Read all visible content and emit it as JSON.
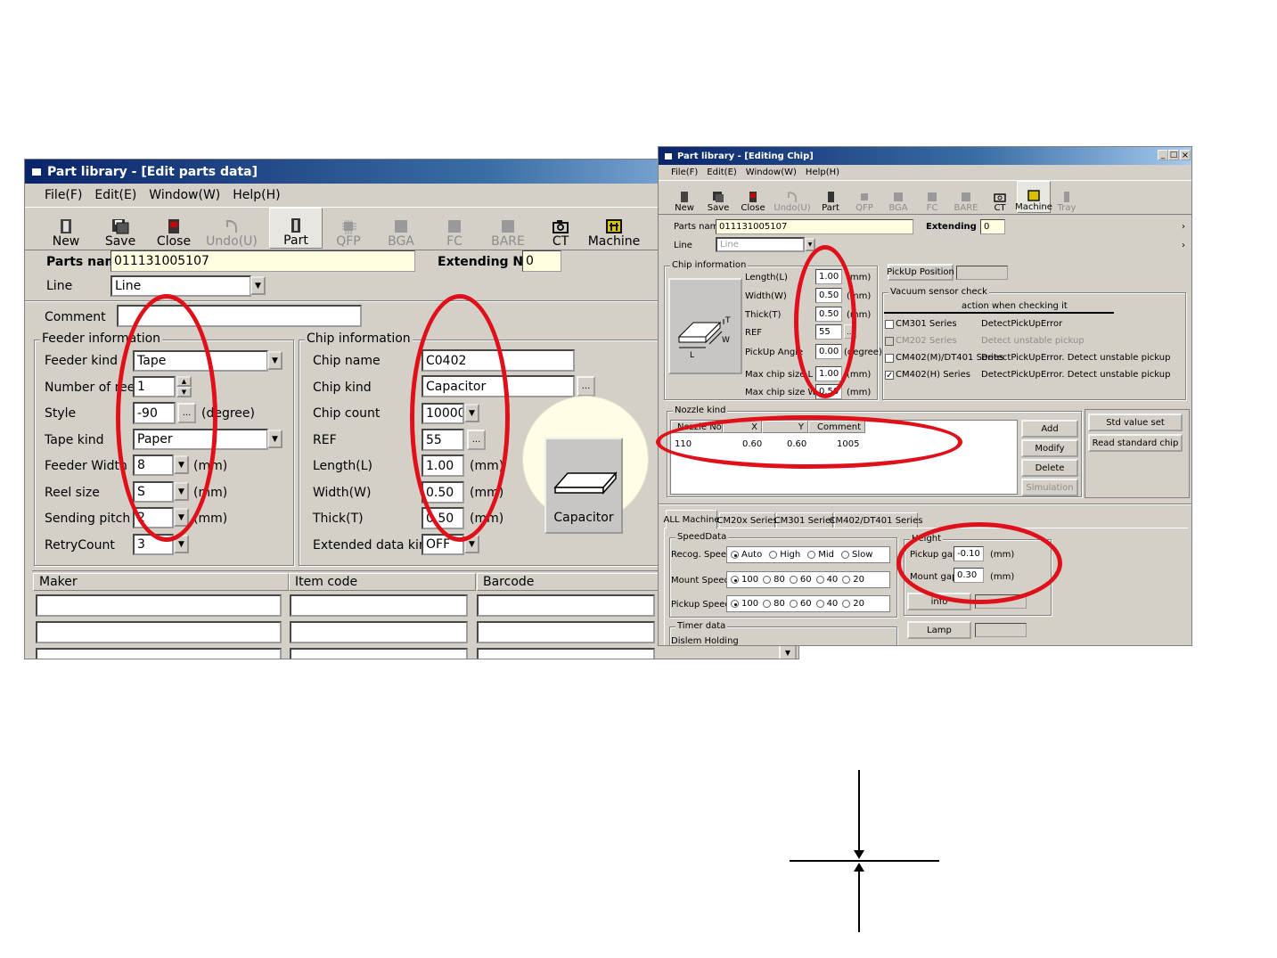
{
  "left_window": {
    "title": "Part library - [Edit parts data]",
    "menu": [
      "File(F)",
      "Edit(E)",
      "Window(W)",
      "Help(H)"
    ],
    "toolbar": [
      "New",
      "Save",
      "Close",
      "Undo(U)",
      "Part",
      "QFP",
      "BGA",
      "FC",
      "BARE",
      "CT",
      "Machine"
    ],
    "parts_name_label": "Parts name",
    "parts_name_value": "011131005107",
    "extending_label": "Extending No",
    "extending_value": "0",
    "line_label": "Line",
    "line_value": "Line",
    "comment_label": "Comment",
    "comment_value": "",
    "feeder": {
      "title": "Feeder information",
      "kind_label": "Feeder kind",
      "kind_value": "Tape",
      "reel_label": "Number of reel",
      "reel_value": "1",
      "style_label": "Style",
      "style_value": "-90",
      "style_unit": "(degree)",
      "tape_label": "Tape kind",
      "tape_value": "Paper",
      "width_label": "Feeder Width",
      "width_value": "8",
      "width_unit": "(mm)",
      "reelsize_label": "Reel size",
      "reelsize_value": "S",
      "reelsize_unit": "(mm)",
      "pitch_label": "Sending pitch",
      "pitch_value": "2",
      "pitch_unit": "(mm)",
      "retry_label": "RetryCount",
      "retry_value": "3"
    },
    "chip": {
      "title": "Chip information",
      "name_label": "Chip name",
      "name_value": "C0402",
      "kind_label": "Chip kind",
      "kind_value": "Capacitor",
      "count_label": "Chip count",
      "count_value": "10000",
      "ref_label": "REF",
      "ref_value": "55",
      "length_label": "Length(L)",
      "length_value": "1.00",
      "length_unit": "(mm)",
      "width_label": "Width(W)",
      "width_value": "0.50",
      "width_unit": "(mm)",
      "thick_label": "Thick(T)",
      "thick_value": "0.50",
      "thick_unit": "(mm)",
      "ext_label": "Extended data kind",
      "ext_value": "OFF",
      "preview_label": "Capacitor"
    },
    "table_headers": [
      "Maker",
      "Item code",
      "Barcode"
    ]
  },
  "right_window": {
    "title": "Part library - [Editing Chip]",
    "menu": [
      "File(F)",
      "Edit(E)",
      "Window(W)",
      "Help(H)"
    ],
    "toolbar": [
      "New",
      "Save",
      "Close",
      "Undo(U)",
      "Part",
      "QFP",
      "BGA",
      "FC",
      "BARE",
      "CT",
      "Machine",
      "Tray"
    ],
    "parts_name_label": "Parts name",
    "parts_name_value": "011131005107",
    "extending_label": "Extending No",
    "extending_value": "0",
    "line_label": "Line",
    "line_value": "Line",
    "chipinfo": {
      "title": "Chip information",
      "length_label": "Length(L)",
      "length_value": "1.00",
      "length_unit": "(mm)",
      "width_label": "Width(W)",
      "width_value": "0.50",
      "width_unit": "(mm)",
      "thick_label": "Thick(T)",
      "thick_value": "0.50",
      "thick_unit": "(mm)",
      "ref_label": "REF",
      "ref_value": "55",
      "angle_label": "PickUp Angle",
      "angle_value": "0.00",
      "angle_unit": "(degree)",
      "maxl_label": "Max chip size L",
      "maxl_value": "1.00",
      "maxl_unit": "(mm)",
      "maxw_label": "Max chip size W",
      "maxw_value": "0.50",
      "maxw_unit": "(mm)",
      "dim_t": "T",
      "dim_w": "W",
      "dim_l": "L"
    },
    "pickup_position_button": "PickUp Position",
    "vacuum": {
      "title": "Vacuum sensor check",
      "header": "action when checking it",
      "rows": [
        {
          "series": "CM301 Series",
          "action": "DetectPickUpError",
          "checked": false,
          "disabled": false
        },
        {
          "series": "CM202 Series",
          "action": "Detect unstable pickup",
          "checked": false,
          "disabled": true
        },
        {
          "series": "CM402(M)/DT401 Series",
          "action": "DetectPickUpError. Detect unstable pickup",
          "checked": false,
          "disabled": false
        },
        {
          "series": "CM402(H) Series",
          "action": "DetectPickUpError. Detect unstable pickup",
          "checked": true,
          "disabled": false
        }
      ]
    },
    "nozzle": {
      "title": "Nozzle kind",
      "headers": [
        "Nozzle No",
        "X",
        "Y",
        "Comment"
      ],
      "rows": [
        [
          "110",
          "0.60",
          "0.60",
          "1005"
        ]
      ],
      "buttons": [
        "Add",
        "Modify",
        "Delete",
        "Simulation"
      ]
    },
    "std_value_button": "Std value set",
    "read_standard_button": "Read standard chip",
    "tabs": [
      "ALL Machine",
      "CM20x Series",
      "CM301 Series",
      "CM402/DT401 Series"
    ],
    "speed": {
      "title": "SpeedData",
      "recog_label": "Recog. Speed",
      "recog_options": [
        "Auto",
        "High",
        "Mid",
        "Slow"
      ],
      "mount_label": "Mount Speed",
      "mount_options": [
        "100",
        "80",
        "60",
        "40",
        "20"
      ],
      "pickup_label": "Pickup Speed",
      "pickup_options": [
        "100",
        "80",
        "60",
        "40",
        "20"
      ]
    },
    "height": {
      "title": "Height",
      "pickup_label": "Pickup gap",
      "pickup_value": "-0.10",
      "pickup_unit": "(mm)",
      "mount_label": "Mount gap",
      "mount_value": "0.30",
      "mount_unit": "(mm)"
    },
    "info_button": "info",
    "lamp_button": "Lamp",
    "timer_title": "Timer data",
    "timer_label": "Dislem Holding"
  },
  "colors": {
    "annotation": "#e0101a",
    "titlebar": "#0a246a",
    "dialog": "#d4d0c8"
  }
}
